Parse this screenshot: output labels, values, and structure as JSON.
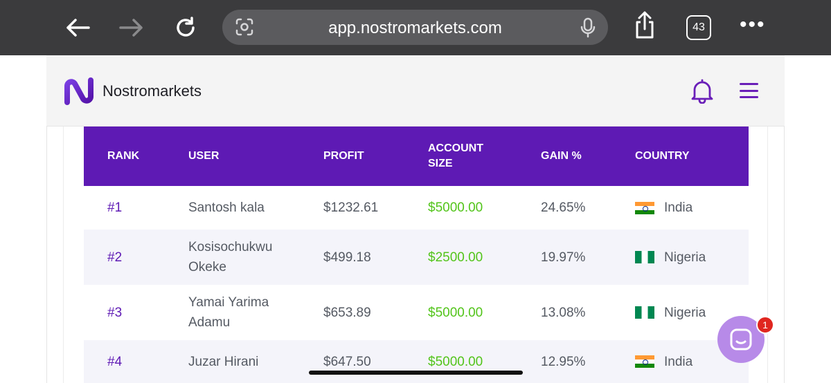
{
  "browser": {
    "url": "app.nostromarkets.com",
    "tab_count": "43",
    "icons": [
      "back-arrow-icon",
      "forward-arrow-icon",
      "reload-icon",
      "visual-search-icon",
      "microphone-icon",
      "share-icon",
      "tabs-icon",
      "more-icon"
    ]
  },
  "header": {
    "brand": "Nostromarkets",
    "accent_color": "#5e1ab4"
  },
  "table": {
    "columns": {
      "rank": "RANK",
      "user": "USER",
      "profit": "PROFIT",
      "account_size_line1": "ACCOUNT",
      "account_size_line2": "SIZE",
      "gain": "GAIN %",
      "country": "COUNTRY"
    },
    "rows": [
      {
        "rank": "#1",
        "user_line1": "Santosh kala",
        "user_line2": "",
        "profit": "$1232.61",
        "account_size": "$5000.00",
        "gain": "24.65%",
        "country": "India",
        "flag": "india-flag-icon"
      },
      {
        "rank": "#2",
        "user_line1": "Kosisochukwu",
        "user_line2": "Okeke",
        "profit": "$499.18",
        "account_size": "$2500.00",
        "gain": "19.97%",
        "country": "Nigeria",
        "flag": "nigeria-flag-icon"
      },
      {
        "rank": "#3",
        "user_line1": "Yamai Yarima",
        "user_line2": "Adamu",
        "profit": "$653.89",
        "account_size": "$5000.00",
        "gain": "13.08%",
        "country": "Nigeria",
        "flag": "nigeria-flag-icon"
      },
      {
        "rank": "#4",
        "user_line1": "Juzar Hirani",
        "user_line2": "",
        "profit": "$647.50",
        "account_size": "$5000.00",
        "gain": "12.95%",
        "country": "India",
        "flag": "india-flag-icon"
      }
    ]
  },
  "chat": {
    "badge": "1"
  }
}
